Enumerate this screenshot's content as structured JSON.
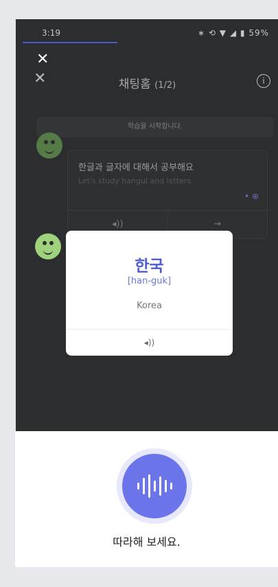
{
  "status": {
    "time": "3:19",
    "battery": "59%"
  },
  "header": {
    "title": "채팅홈",
    "count": "(1/2)"
  },
  "notice": "학습을 시작합니다.",
  "bubble": {
    "korean": "한글과 글자에 대해서 공부해요",
    "english": "Let's study hangul and letters.",
    "translate_icon": "translate-icon"
  },
  "card": {
    "word": "한국",
    "romanization": "[han-guk]",
    "meaning": "Korea"
  },
  "bottom": {
    "prompt": "따라해 보세요."
  },
  "colors": {
    "accent": "#6b74e8",
    "word": "#4f5fd3",
    "overlay": "#2c2d2f"
  }
}
